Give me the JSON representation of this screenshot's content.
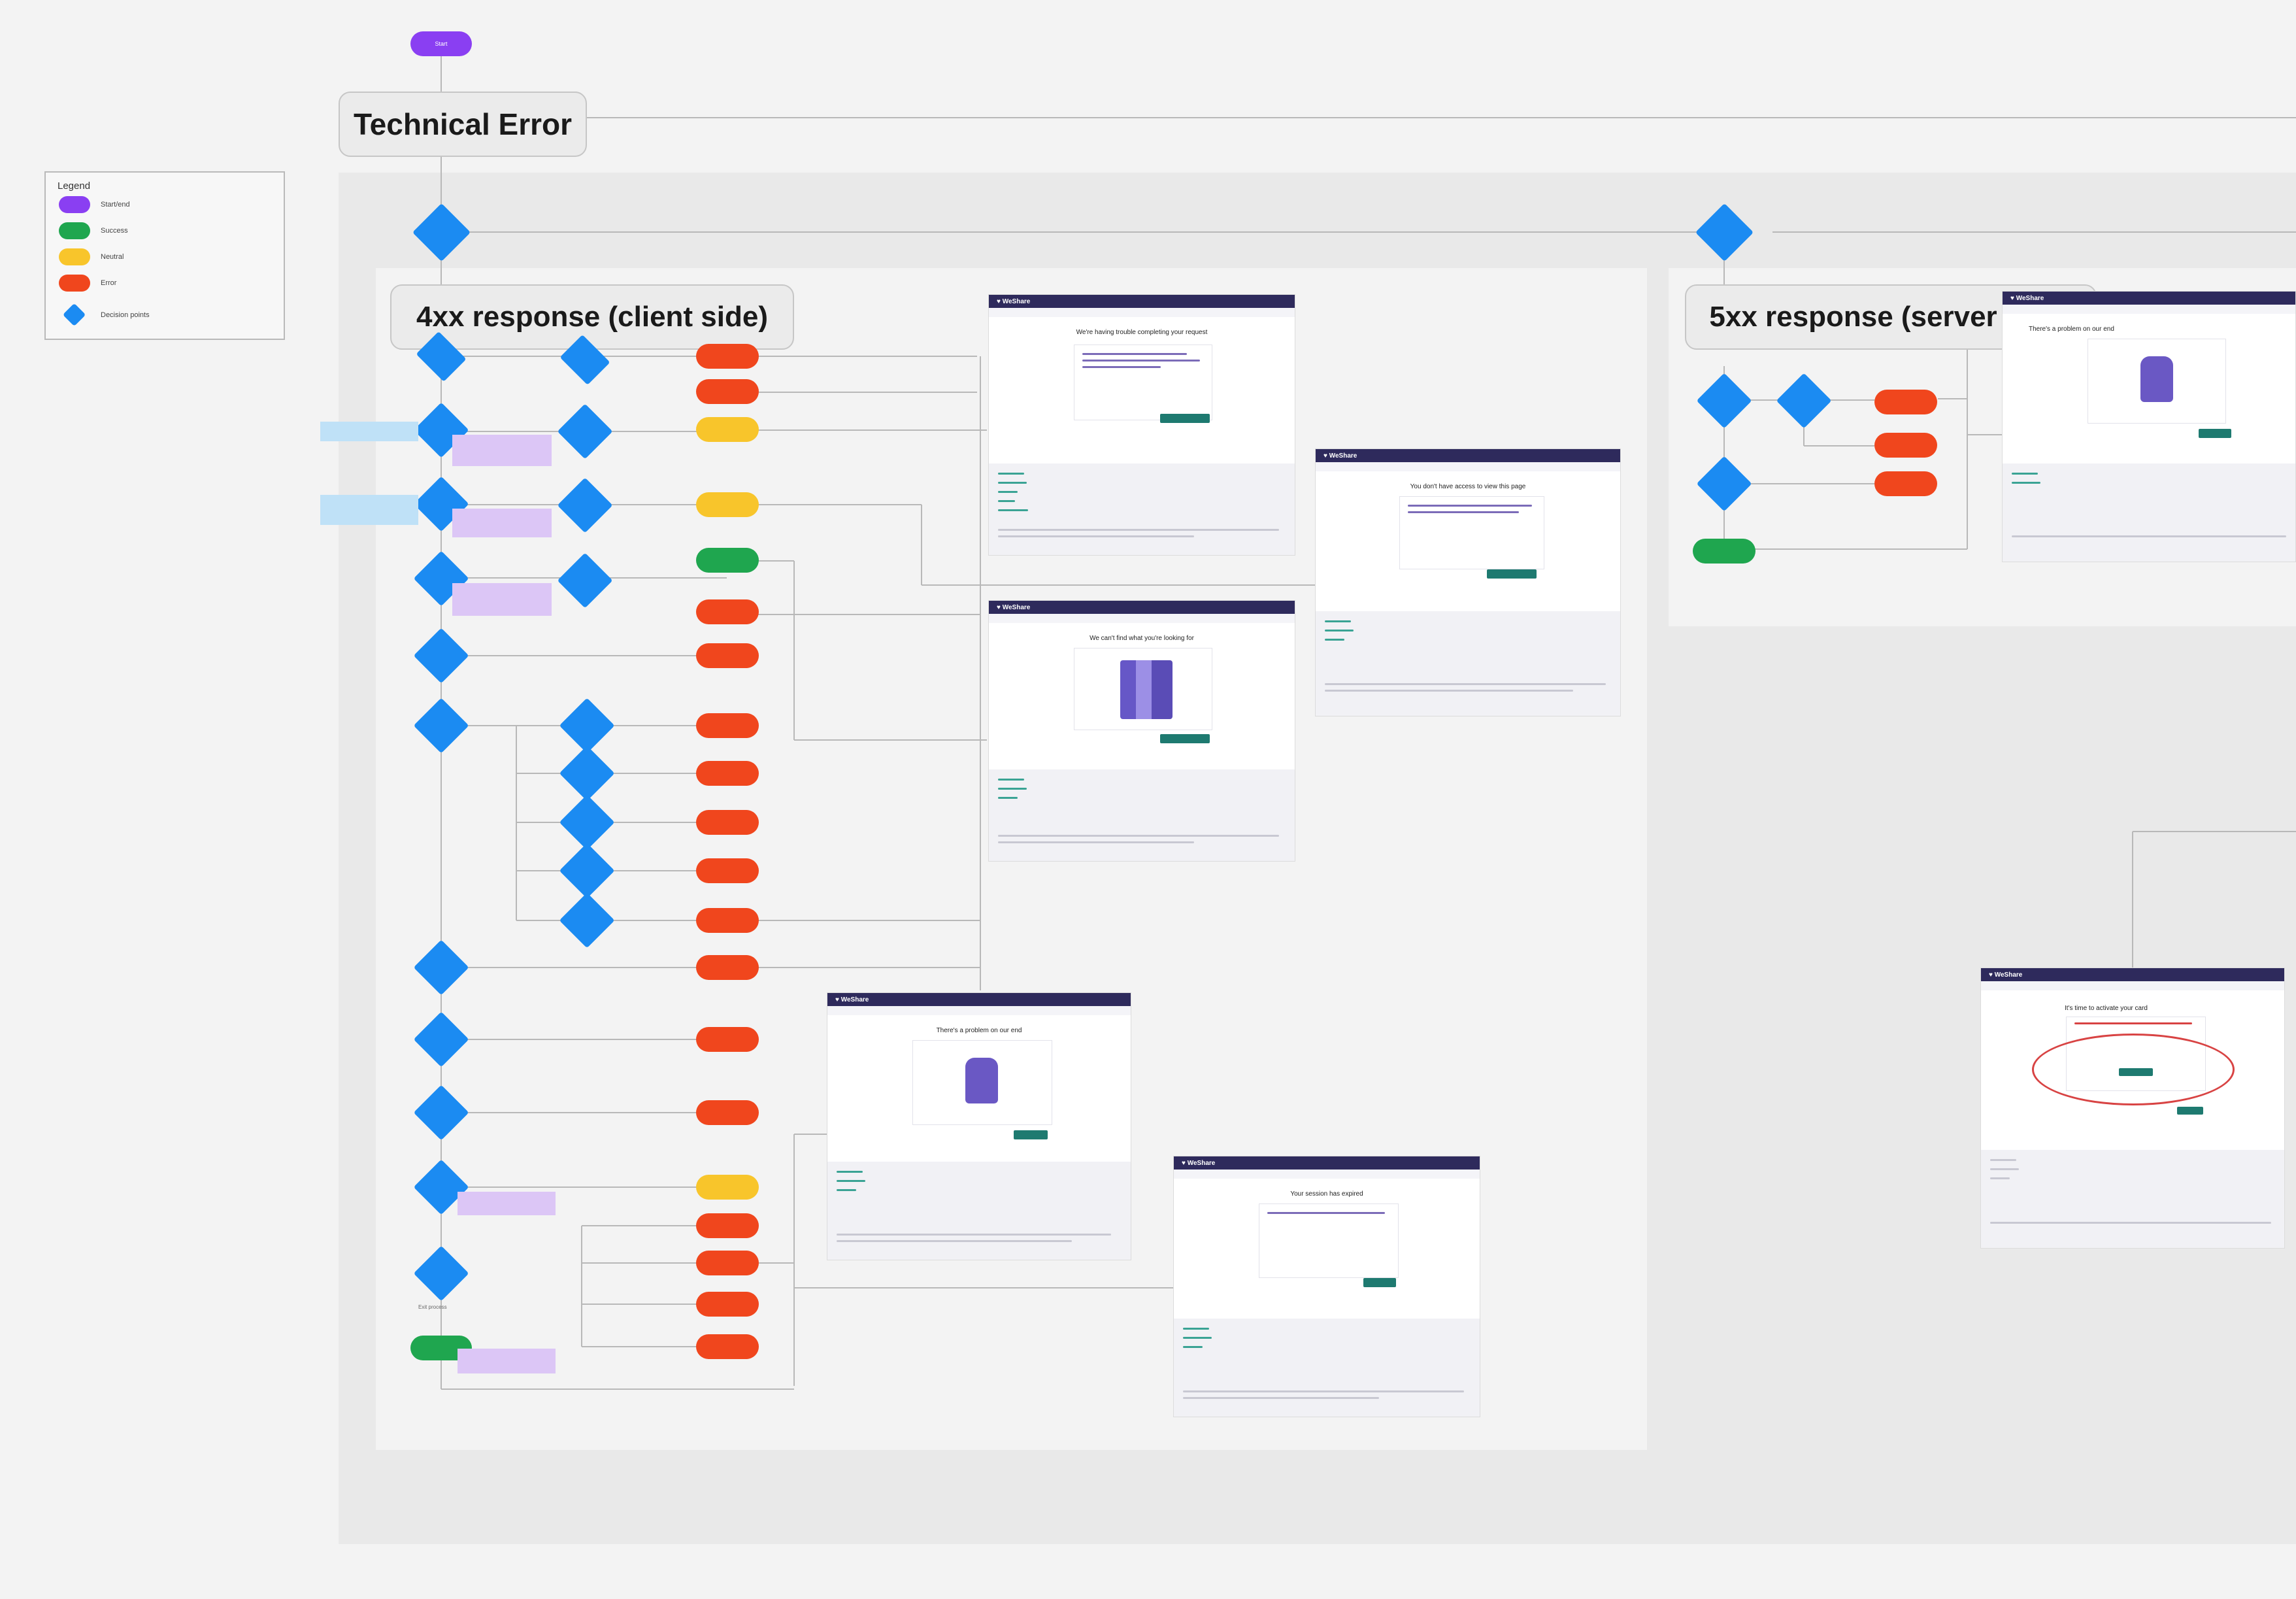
{
  "start": {
    "label": "Start",
    "color": "#8a3ff2"
  },
  "main_title": "Technical Error",
  "legend": {
    "title": "Legend",
    "items": [
      {
        "label": "Start/end",
        "color": "#8a3ff2",
        "shape": "pill"
      },
      {
        "label": "Success",
        "color": "#1fa64f",
        "shape": "pill"
      },
      {
        "label": "Neutral",
        "color": "#f8c52b",
        "shape": "pill"
      },
      {
        "label": "Error",
        "color": "#f0461d",
        "shape": "pill"
      },
      {
        "label": "Decision points",
        "color": "#1b8bf2",
        "shape": "diamond"
      }
    ]
  },
  "sections": {
    "client": {
      "title": "4xx response (client side)"
    },
    "server": {
      "title": "5xx response (server side)"
    }
  },
  "colors": {
    "start": "#8a3ff2",
    "success": "#1fa64f",
    "neutral": "#f8c52b",
    "error": "#f0461d",
    "decision": "#1b8bf2",
    "note_purple": "#dcc6f6",
    "note_blue": "#bfe1f7",
    "highlight_oval": "#d84343"
  },
  "screens": {
    "s1": {
      "brand": "♥ WeShare",
      "heading": "We're having trouble completing your request"
    },
    "s2": {
      "brand": "♥ WeShare",
      "heading": "You don't have access to view this page"
    },
    "s3": {
      "brand": "♥ WeShare",
      "heading": "We can't find what you're looking for"
    },
    "s4": {
      "brand": "♥ WeShare",
      "heading": "There's a problem on our end"
    },
    "s5": {
      "brand": "♥ WeShare",
      "heading": "Your session has expired"
    },
    "s6": {
      "brand": "♥ WeShare",
      "heading": "There's a problem on our end"
    },
    "s7": {
      "brand": "♥ WeShare",
      "heading": "It's time to activate your card"
    }
  },
  "exit_label": "Exit process"
}
